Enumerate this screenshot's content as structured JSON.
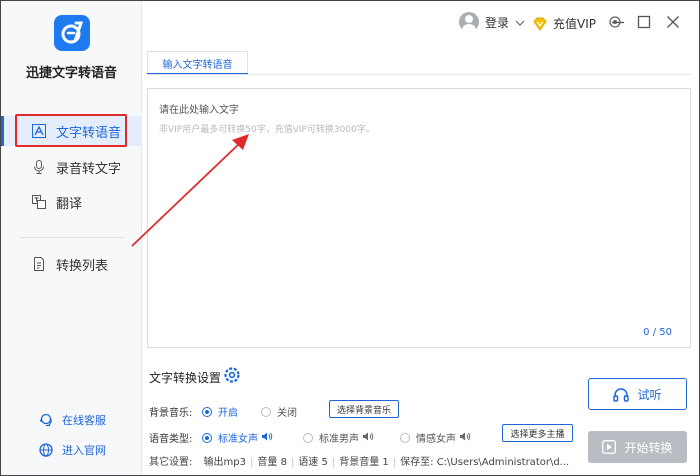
{
  "app": {
    "name": "迅捷文字转语音"
  },
  "sidebar": {
    "items": [
      {
        "label": "文字转语音",
        "icon": "text-to-speech-icon",
        "active": true
      },
      {
        "label": "录音转文字",
        "icon": "microphone-icon",
        "active": false
      },
      {
        "label": "翻译",
        "icon": "translate-icon",
        "active": false
      },
      {
        "label": "转换列表",
        "icon": "convert-list-icon",
        "active": false
      }
    ],
    "links": [
      {
        "label": "在线客服",
        "icon": "customer-service-icon"
      },
      {
        "label": "进入官网",
        "icon": "globe-icon"
      }
    ]
  },
  "header": {
    "login_label": "登录",
    "vip_label": "充值VIP",
    "controls": [
      "gear-icon",
      "minimize-icon",
      "maximize-icon",
      "close-icon"
    ]
  },
  "tabs": [
    {
      "label": "输入文字转语音",
      "active": true
    }
  ],
  "editor": {
    "placeholder": "请在此处输入文字",
    "hint": "非VIP用户最多可转换50字，充值VIP可转换3000字。",
    "count": "0 / 50"
  },
  "settings": {
    "title": "文字转换设置",
    "bg_music": {
      "label": "背景音乐:",
      "options": [
        "开启",
        "关闭"
      ],
      "selected": "开启",
      "button": "选择背景音乐"
    },
    "voice": {
      "label": "语音类型:",
      "options": [
        "标准女声",
        "标准男声",
        "情感女声"
      ],
      "selected": "标准女声",
      "button": "选择更多主播"
    },
    "other": {
      "label": "其它设置:",
      "items": [
        "输出mp3",
        "音量 8",
        "语速 5",
        "背景音量 1",
        "保存至: C:\\Users\\Administrator\\d..."
      ]
    }
  },
  "actions": {
    "listen": "试听",
    "convert": "开始转换"
  },
  "colors": {
    "accent": "#1e66d8",
    "highlight": "#e02a2a",
    "disabled": "#b9bcc2"
  }
}
